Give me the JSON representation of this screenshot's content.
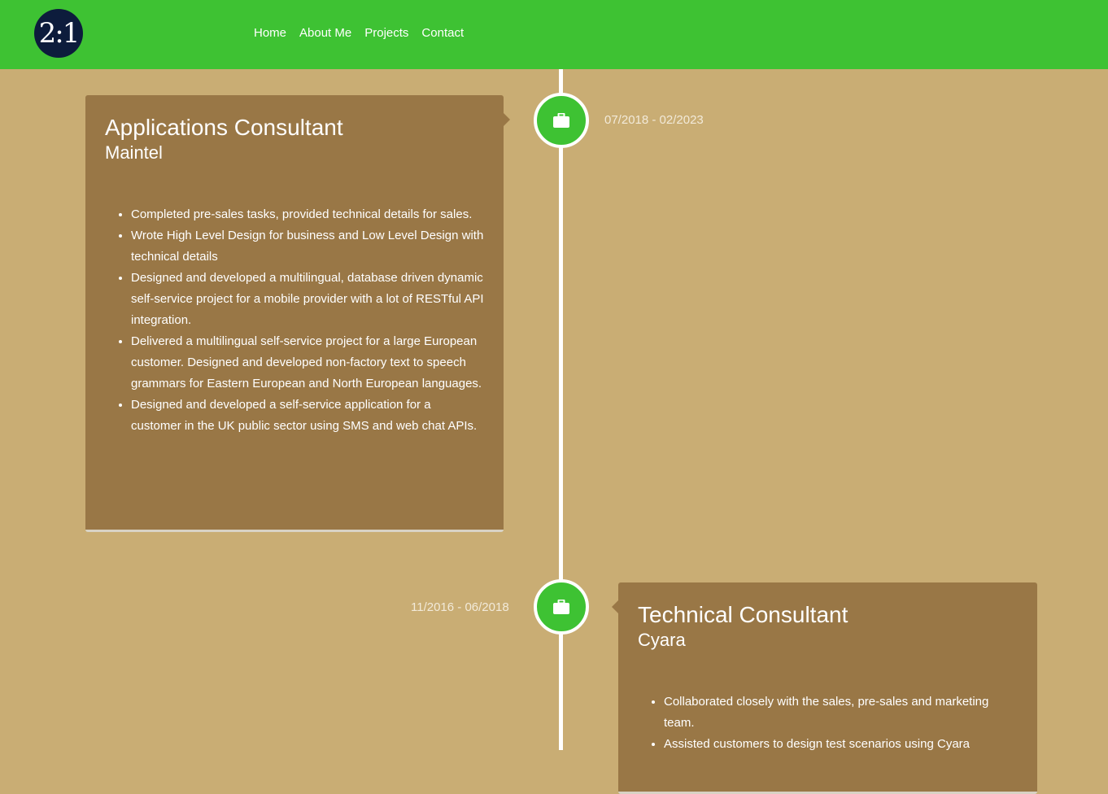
{
  "header": {
    "logo_text": "2:1",
    "nav": [
      "Home",
      "About Me",
      "Projects",
      "Contact"
    ]
  },
  "colors": {
    "header_bg": "#3ec233",
    "page_bg": "#c9ad74",
    "card_bg": "#997746",
    "node_bg": "#3ec233",
    "logo_bg": "#0d1c3c"
  },
  "timeline": [
    {
      "icon": "briefcase-icon",
      "date": "07/2018 - 02/2023",
      "title": "Applications Consultant",
      "company": "Maintel",
      "bullets": [
        "Completed pre-sales tasks, provided technical details for sales.",
        "Wrote High Level Design for business and Low Level Design with technical details",
        "Designed and developed a multilingual, database driven dynamic self-service project for a mobile provider with a lot of RESTful API integration.",
        "Delivered a multilingual self-service project for a large European customer. Designed and developed non-factory text to speech grammars for Eastern European and North European languages.",
        "Designed and developed a self-service application for a customer in the UK public sector using SMS and web chat APIs."
      ]
    },
    {
      "icon": "briefcase-icon",
      "date": "11/2016 - 06/2018",
      "title": "Technical Consultant",
      "company": "Cyara",
      "bullets": [
        "Collaborated closely with the sales, pre-sales and marketing team.",
        "Assisted customers to design test scenarios using Cyara"
      ]
    }
  ]
}
